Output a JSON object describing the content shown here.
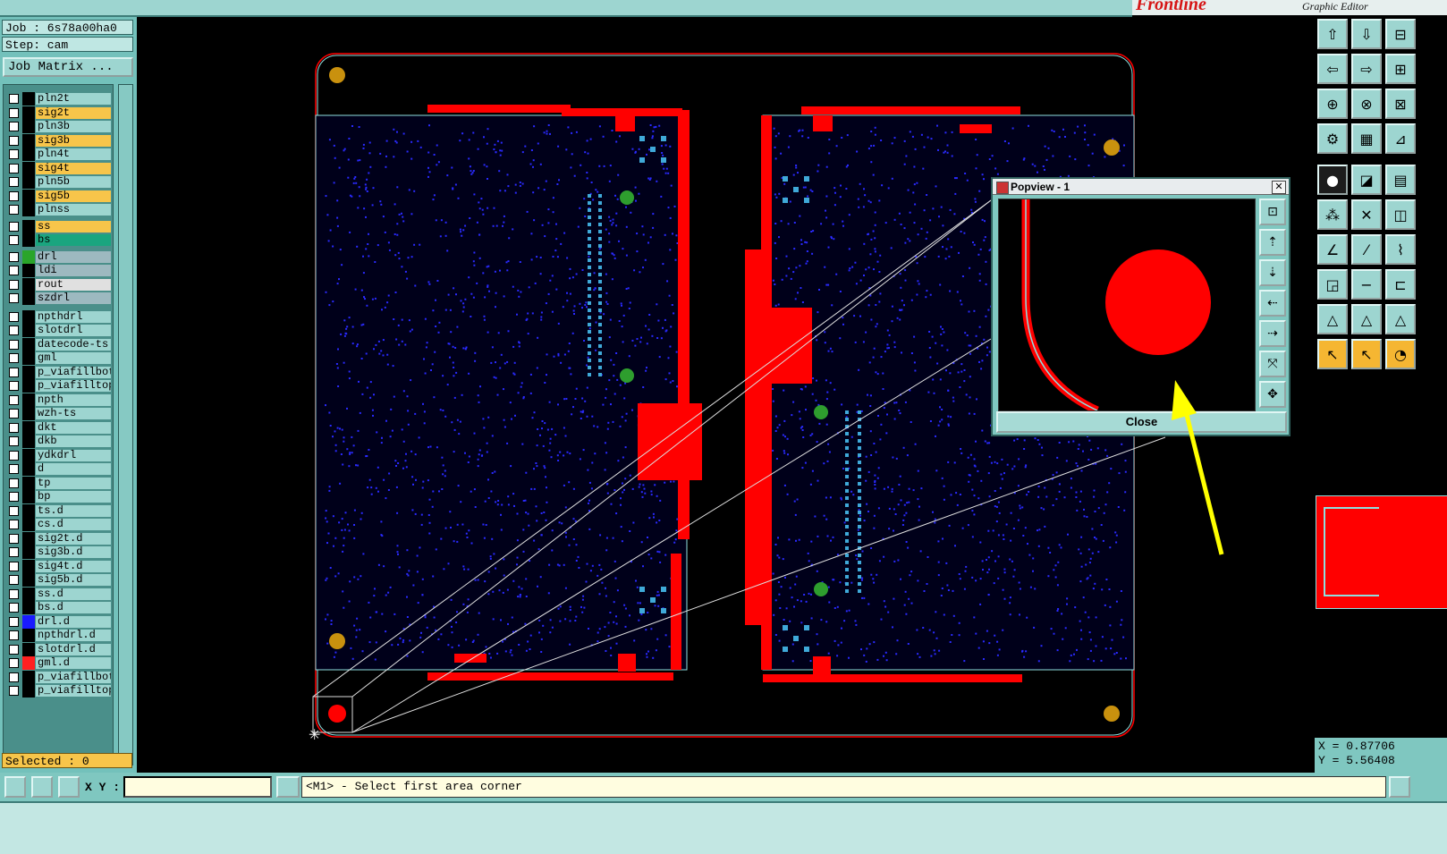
{
  "app": {
    "brand": "Frontline",
    "subtitle": "Graphic Editor"
  },
  "info": {
    "job": "Job : 6s78a00ha0",
    "step": "Step: cam",
    "job_matrix": "Job Matrix ..."
  },
  "layers": [
    {
      "name": "pln2t",
      "color": "#9dd5d0"
    },
    {
      "name": "sig2t",
      "color": "#f7c54a"
    },
    {
      "name": "pln3b",
      "color": "#9dd5d0"
    },
    {
      "name": "sig3b",
      "color": "#f7c54a"
    },
    {
      "name": "pln4t",
      "color": "#9dd5d0"
    },
    {
      "name": "sig4t",
      "color": "#f7c54a"
    },
    {
      "name": "pln5b",
      "color": "#9dd5d0"
    },
    {
      "name": "sig5b",
      "color": "#f7c54a"
    },
    {
      "name": "plnss",
      "color": "#9dd5d0"
    },
    {
      "name": "ss",
      "color": "#f7c54a"
    },
    {
      "name": "bs",
      "color": "#1aa57f"
    },
    {
      "name": "drl",
      "color": "#9db9c0",
      "swatch": "#2aa52a"
    },
    {
      "name": "ldi",
      "color": "#9db9c0"
    },
    {
      "name": "rout",
      "color": "#e0e0e0"
    },
    {
      "name": "szdrl",
      "color": "#9db9c0"
    },
    {
      "name": "npthdrl",
      "color": "#9dd5d0"
    },
    {
      "name": "slotdrl",
      "color": "#9dd5d0"
    },
    {
      "name": "datecode-ts",
      "color": "#9dd5d0"
    },
    {
      "name": "gml",
      "color": "#9dd5d0"
    },
    {
      "name": "p_viafillbot",
      "color": "#9dd5d0"
    },
    {
      "name": "p_viafilltop",
      "color": "#9dd5d0"
    },
    {
      "name": "npth",
      "color": "#9dd5d0"
    },
    {
      "name": "wzh-ts",
      "color": "#9dd5d0"
    },
    {
      "name": "dkt",
      "color": "#9dd5d0"
    },
    {
      "name": "dkb",
      "color": "#9dd5d0"
    },
    {
      "name": "ydkdrl",
      "color": "#9dd5d0"
    },
    {
      "name": "d",
      "color": "#9dd5d0"
    },
    {
      "name": "tp",
      "color": "#9dd5d0"
    },
    {
      "name": "bp",
      "color": "#9dd5d0"
    },
    {
      "name": "ts.d",
      "color": "#9dd5d0"
    },
    {
      "name": "cs.d",
      "color": "#9dd5d0"
    },
    {
      "name": "sig2t.d",
      "color": "#9dd5d0"
    },
    {
      "name": "sig3b.d",
      "color": "#9dd5d0"
    },
    {
      "name": "sig4t.d",
      "color": "#9dd5d0"
    },
    {
      "name": "sig5b.d",
      "color": "#9dd5d0"
    },
    {
      "name": "ss.d",
      "color": "#9dd5d0"
    },
    {
      "name": "bs.d",
      "color": "#9dd5d0"
    },
    {
      "name": "drl.d",
      "color": "#9dd5d0",
      "swatch": "#1a1aff"
    },
    {
      "name": "npthdrl.d",
      "color": "#9dd5d0"
    },
    {
      "name": "slotdrl.d",
      "color": "#9dd5d0"
    },
    {
      "name": "gml.d",
      "color": "#9dd5d0",
      "swatch": "#ff2020"
    },
    {
      "name": "p_viafillbot",
      "color": "#9dd5d0"
    },
    {
      "name": "p_viafilltop",
      "color": "#9dd5d0"
    }
  ],
  "selected": "Selected : 0",
  "popview": {
    "title": "Popview - 1",
    "close_label": "Close"
  },
  "coords": {
    "x": "X = 0.87706",
    "y": "Y = 5.56408"
  },
  "bottom": {
    "xy_label": "X Y :",
    "xy_value": "",
    "message": "<M1> - Select first area corner"
  },
  "colors": {
    "panel": "#73c1bb",
    "copper": "#ff0000",
    "outline": "#8fe0e0",
    "pad": "#3fa9d8",
    "via": "#2a2aff"
  }
}
